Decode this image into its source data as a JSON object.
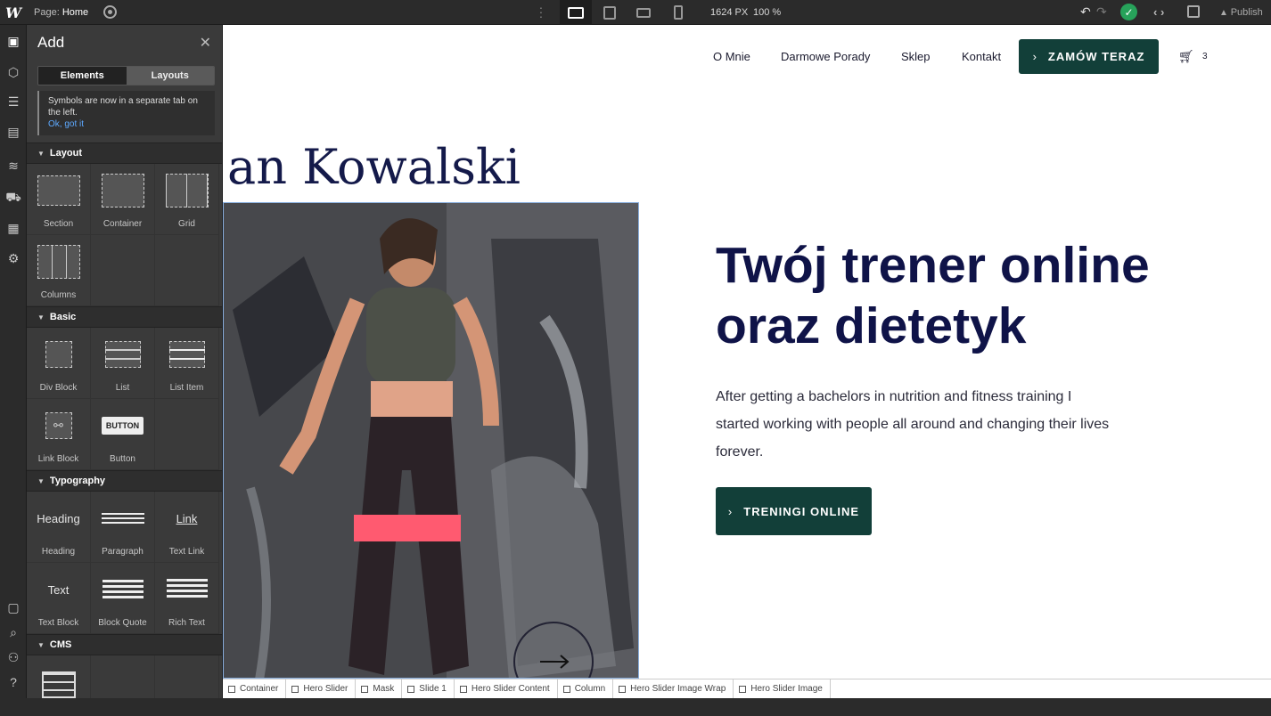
{
  "topbar": {
    "logo": "W",
    "page_prefix": "Page:",
    "page_name": "Home",
    "width_readout": "1624 PX",
    "zoom": "100 %",
    "publish": "Publish"
  },
  "panel": {
    "title": "Add",
    "tabs": [
      "Elements",
      "Layouts"
    ],
    "notice_text": "Symbols are now in a separate tab on the left.",
    "notice_link": "Ok, got it",
    "sections": {
      "layout": {
        "title": "Layout",
        "items": [
          "Section",
          "Container",
          "Grid",
          "Columns"
        ]
      },
      "basic": {
        "title": "Basic",
        "items": [
          "Div Block",
          "List",
          "List Item",
          "Link Block",
          "Button"
        ],
        "button_icon": "BUTTON"
      },
      "typography": {
        "title": "Typography",
        "items": [
          "Heading",
          "Paragraph",
          "Text Link",
          "Text Block",
          "Block Quote",
          "Rich Text"
        ],
        "icon_heading": "Heading",
        "icon_link": "Link",
        "icon_text": "Text"
      },
      "cms": {
        "title": "CMS"
      }
    }
  },
  "site": {
    "nav": [
      "O Mnie",
      "Darmowe Porady",
      "Sklep",
      "Kontakt"
    ],
    "cta_top": "ZAMÓW TERAZ",
    "cart_count": "3",
    "brand": "an Kowalski",
    "hero_title_line1": "Twój trener online",
    "hero_title_line2": "oraz dietetyk",
    "hero_text": "After getting a bachelors in nutrition and fitness training I started working with people all around and changing their lives forever.",
    "cta_main": "TRENINGI ONLINE",
    "colors": {
      "accent": "#123f39",
      "heading": "#0f1348"
    }
  },
  "breadcrumbs": [
    "Container",
    "Hero Slider",
    "Mask",
    "Slide 1",
    "Hero Slider Content",
    "Column",
    "Hero Slider Image Wrap",
    "Hero Slider Image"
  ]
}
